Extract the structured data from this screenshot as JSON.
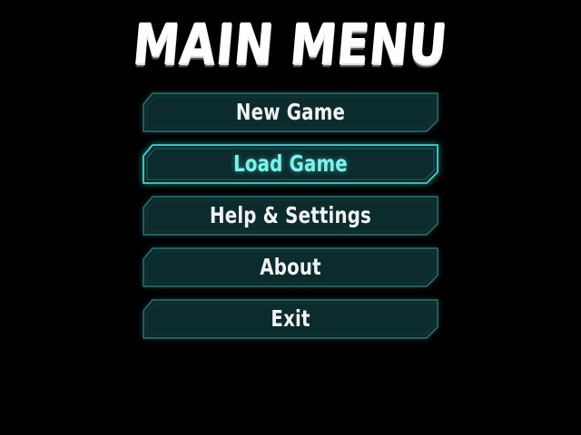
{
  "title": "MAIN MENU",
  "colors": {
    "background": "#000000",
    "button_fill": "#0b2b2c",
    "button_border": "#2a7373",
    "active_border": "#3fd1cf",
    "active_text": "#7ef2ec",
    "text": "#f2f2f2"
  },
  "menu": {
    "items": [
      {
        "label": "New Game",
        "active": false
      },
      {
        "label": "Load Game",
        "active": true
      },
      {
        "label": "Help & Settings",
        "active": false
      },
      {
        "label": "About",
        "active": false
      },
      {
        "label": "Exit",
        "active": false
      }
    ]
  }
}
